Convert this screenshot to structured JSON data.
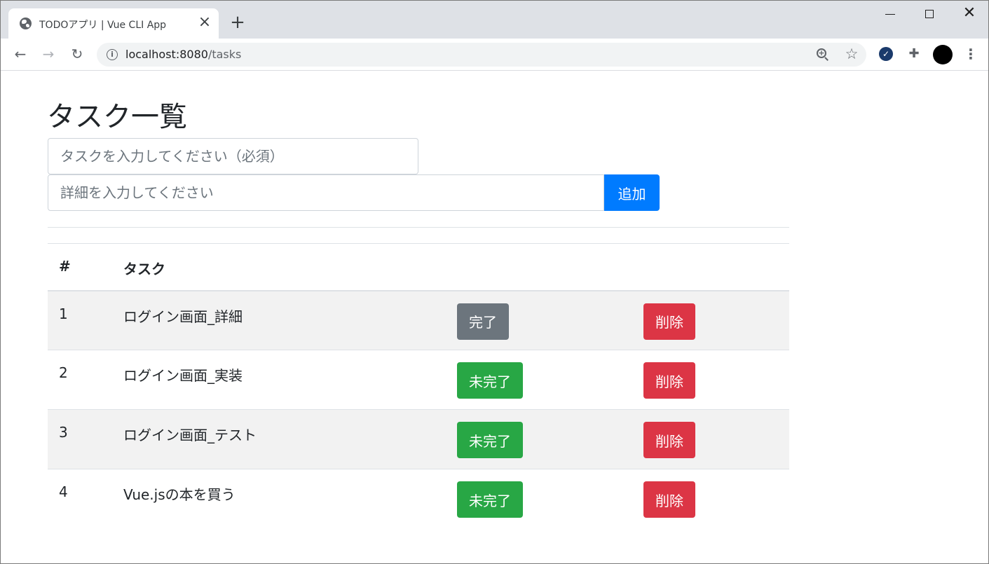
{
  "browser": {
    "tab_title": "TODOアプリ | Vue CLI App",
    "tab_close": "×",
    "new_tab": "+",
    "url_host": "localhost:8080",
    "url_path": "/tasks",
    "icons": {
      "favicon": "globe-icon",
      "back": "arrow-left-icon",
      "forward": "arrow-right-icon",
      "reload": "reload-icon",
      "info": "info-icon",
      "zoom": "zoom-in-icon",
      "bookmark": "star-icon",
      "extension_check": "check-circle-icon",
      "extensions": "puzzle-icon",
      "menu": "more-vertical-icon"
    }
  },
  "page": {
    "title": "タスク一覧",
    "task_placeholder": "タスクを入力してください（必須）",
    "detail_placeholder": "詳細を入力してください",
    "add_label": "追加",
    "table": {
      "headers": [
        "#",
        "タスク",
        "",
        ""
      ],
      "rows": [
        {
          "num": "1",
          "name": "ログイン画面_詳細",
          "status_label": "完了",
          "status": "done",
          "delete_label": "削除"
        },
        {
          "num": "2",
          "name": "ログイン画面_実装",
          "status_label": "未完了",
          "status": "undone",
          "delete_label": "削除"
        },
        {
          "num": "3",
          "name": "ログイン画面_テスト",
          "status_label": "未完了",
          "status": "undone",
          "delete_label": "削除"
        },
        {
          "num": "4",
          "name": "Vue.jsの本を買う",
          "status_label": "未完了",
          "status": "undone",
          "delete_label": "削除"
        }
      ]
    }
  },
  "colors": {
    "primary": "#007bff",
    "secondary": "#6c757d",
    "success": "#28a745",
    "danger": "#dc3545"
  }
}
